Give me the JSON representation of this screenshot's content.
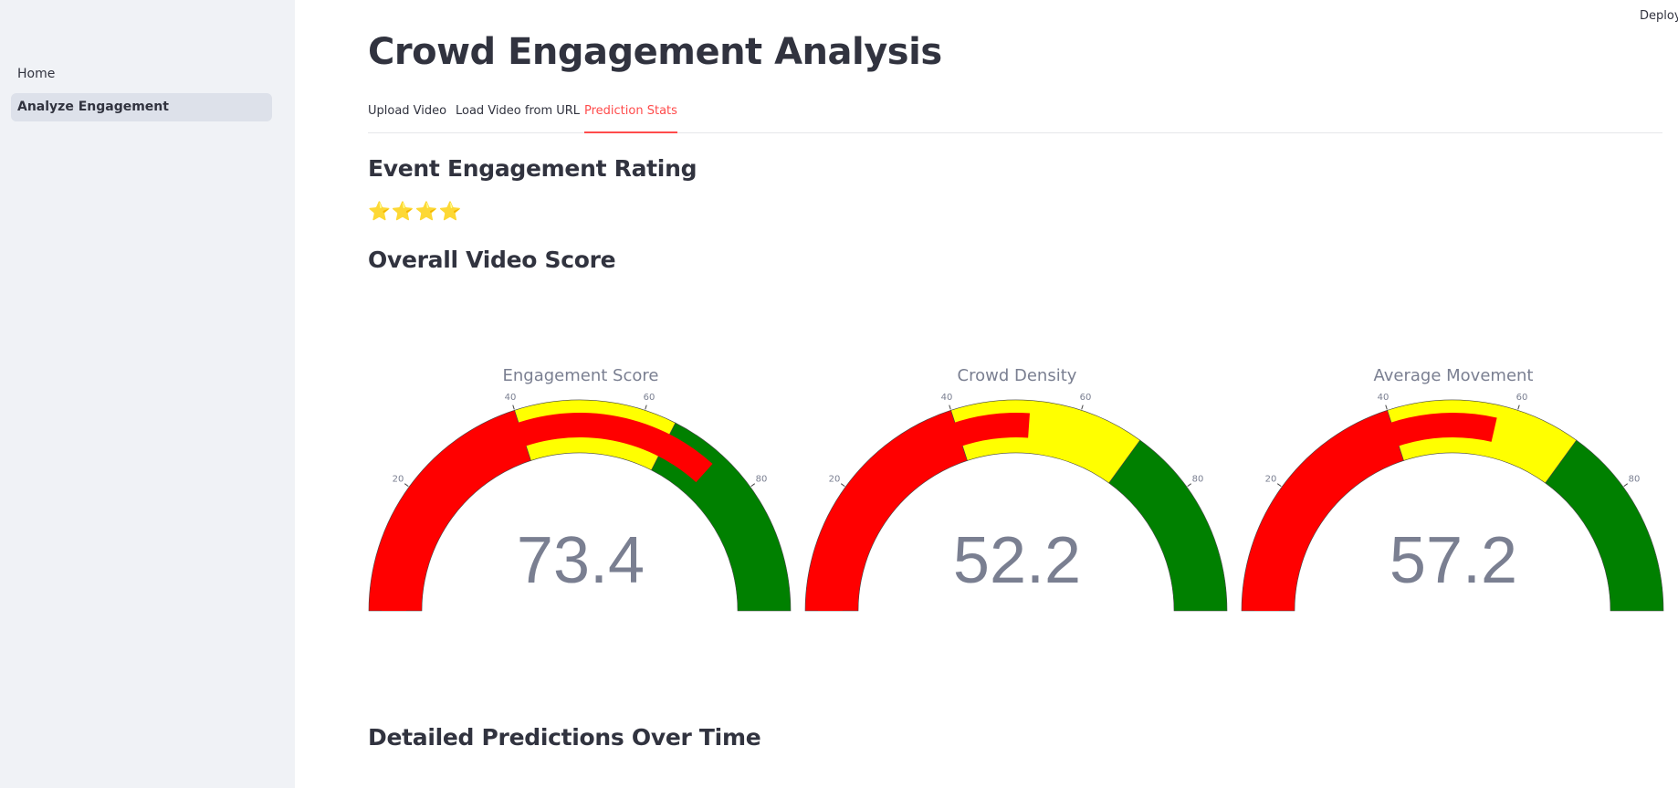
{
  "sidebar": {
    "items": [
      {
        "label": "Home",
        "active": false
      },
      {
        "label": "Analyze Engagement",
        "active": true
      }
    ]
  },
  "header": {
    "deploy_label": "Deploy"
  },
  "main": {
    "title": "Crowd Engagement Analysis",
    "tabs": [
      {
        "label": "Upload Video",
        "active": false
      },
      {
        "label": "Load Video from URL",
        "active": false
      },
      {
        "label": "Prediction Stats",
        "active": true
      }
    ],
    "rating_heading": "Event Engagement Rating",
    "rating_stars": "⭐⭐⭐⭐",
    "rating_value": 4,
    "overall_heading": "Overall Video Score",
    "detailed_heading": "Detailed Predictions Over Time"
  },
  "colors": {
    "accent": "#ff4b4b",
    "band_low": "#ff0000",
    "band_mid": "#ffff00",
    "band_high": "#008000"
  },
  "chart_data": [
    {
      "type": "gauge",
      "title": "Engagement Score",
      "value": 73.4,
      "range": [
        0,
        100
      ],
      "ticks": [
        20,
        40,
        60,
        80
      ],
      "steps": [
        {
          "range": [
            0,
            40
          ],
          "color": "red"
        },
        {
          "range": [
            40,
            65
          ],
          "color": "yellow"
        },
        {
          "range": [
            65,
            100
          ],
          "color": "green"
        }
      ]
    },
    {
      "type": "gauge",
      "title": "Crowd Density",
      "value": 52.2,
      "range": [
        0,
        100
      ],
      "ticks": [
        20,
        40,
        60,
        80
      ],
      "steps": [
        {
          "range": [
            0,
            40
          ],
          "color": "red"
        },
        {
          "range": [
            40,
            70
          ],
          "color": "yellow"
        },
        {
          "range": [
            70,
            100
          ],
          "color": "green"
        }
      ]
    },
    {
      "type": "gauge",
      "title": "Average Movement",
      "value": 57.2,
      "range": [
        0,
        100
      ],
      "ticks": [
        20,
        40,
        60,
        80
      ],
      "steps": [
        {
          "range": [
            0,
            40
          ],
          "color": "red"
        },
        {
          "range": [
            40,
            70
          ],
          "color": "yellow"
        },
        {
          "range": [
            70,
            100
          ],
          "color": "green"
        }
      ]
    }
  ]
}
